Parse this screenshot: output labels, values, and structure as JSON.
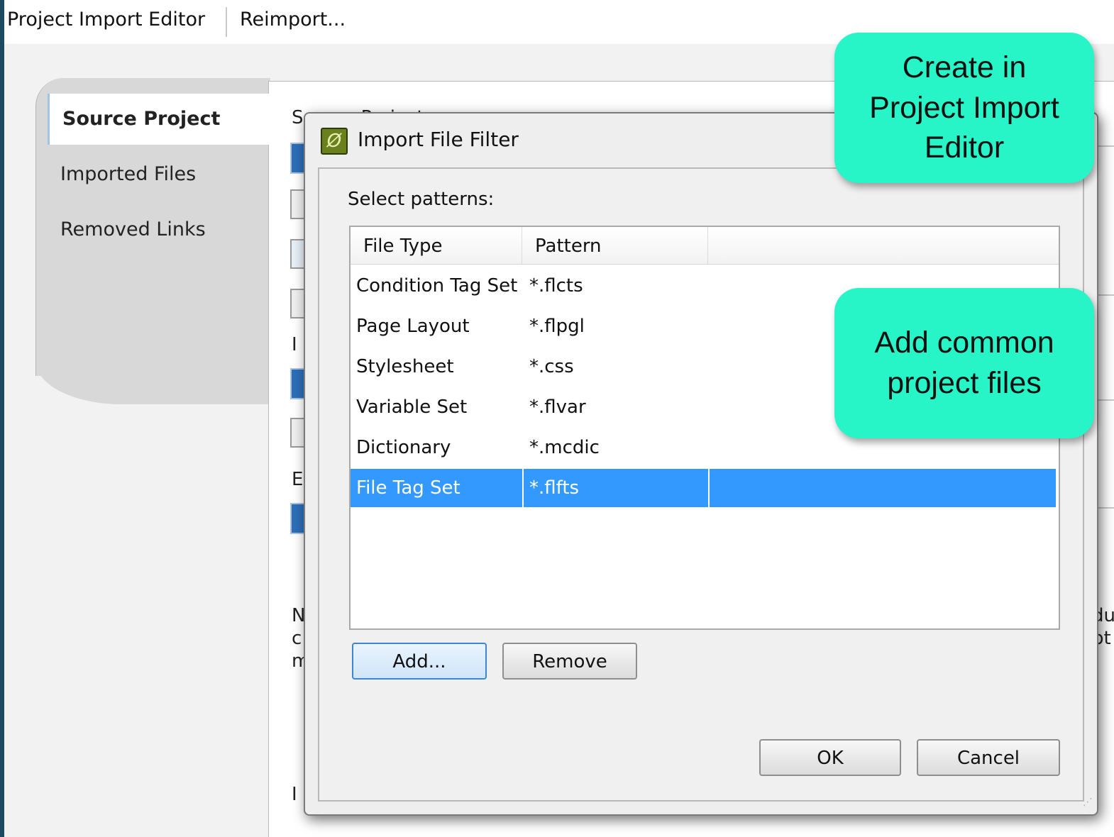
{
  "toolbar": {
    "editor_tab_label": "Project Import Editor",
    "reimport_label": "Reimport..."
  },
  "side_tabs": [
    {
      "label": "Source Project",
      "active": true
    },
    {
      "label": "Imported Files",
      "active": false
    },
    {
      "label": "Removed Links",
      "active": false
    }
  ],
  "background_fragments": {
    "source_heading": "Source Project",
    "frag_i1": "I",
    "frag_e": "E",
    "frag_n": "N",
    "frag_c": "c",
    "frag_m": "m",
    "frag_i2": "I",
    "frag_duc": "duc",
    "frag_pt": "pt"
  },
  "dialog": {
    "title": "Import File Filter",
    "select_label": "Select patterns:",
    "columns": [
      "File Type",
      "Pattern",
      ""
    ],
    "rows": [
      {
        "file_type": "Condition Tag Set",
        "pattern": "*.flcts",
        "selected": false
      },
      {
        "file_type": "Page Layout",
        "pattern": "*.flpgl",
        "selected": false
      },
      {
        "file_type": "Stylesheet",
        "pattern": "*.css",
        "selected": false
      },
      {
        "file_type": "Variable Set",
        "pattern": "*.flvar",
        "selected": false
      },
      {
        "file_type": "Dictionary",
        "pattern": "*.mcdic",
        "selected": false
      },
      {
        "file_type": "File Tag Set",
        "pattern": "*.flfts",
        "selected": true
      }
    ],
    "buttons": {
      "add": "Add...",
      "remove": "Remove",
      "ok": "OK",
      "cancel": "Cancel"
    }
  },
  "callouts": {
    "create": {
      "lines": [
        "Create in",
        "Project Import",
        "Editor"
      ]
    },
    "add_common": {
      "lines": [
        "Add common",
        "project files"
      ]
    }
  },
  "colors": {
    "callout": "#27f5c8",
    "selection": "#3399ff",
    "frame": "#1d4a63"
  }
}
